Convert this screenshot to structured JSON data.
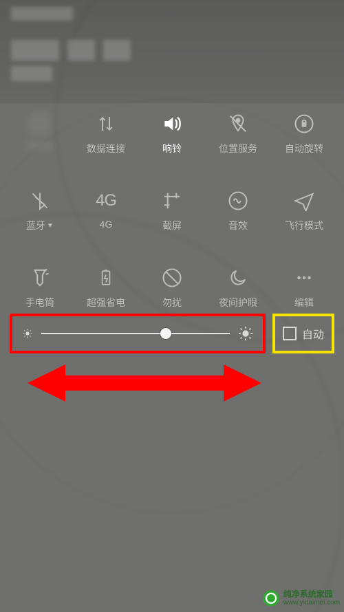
{
  "tiles": {
    "data": {
      "label": "数据连接"
    },
    "ring": {
      "label": "响铃"
    },
    "location": {
      "label": "位置服务"
    },
    "rotate": {
      "label": "自动旋转"
    },
    "bluetooth": {
      "label": "蓝牙"
    },
    "fourg": {
      "label": "4G",
      "iconText": "4G"
    },
    "screenshot": {
      "label": "截屏"
    },
    "sound": {
      "label": "音效"
    },
    "airplane": {
      "label": "飞行模式"
    },
    "torch": {
      "label": "手电筒"
    },
    "battery": {
      "label": "超强省电"
    },
    "dnd": {
      "label": "勿扰"
    },
    "night": {
      "label": "夜间护眼"
    },
    "edit": {
      "label": "编辑"
    }
  },
  "brightness": {
    "auto_label": "自动",
    "value_percent": 66
  },
  "watermark": {
    "line1": "纯净系统家园",
    "line2": "www.yidaimei.com"
  },
  "annotations": {
    "slider_highlight_color": "#ff0000",
    "auto_highlight_color": "#f7e400",
    "arrow_color": "#ff0000"
  }
}
